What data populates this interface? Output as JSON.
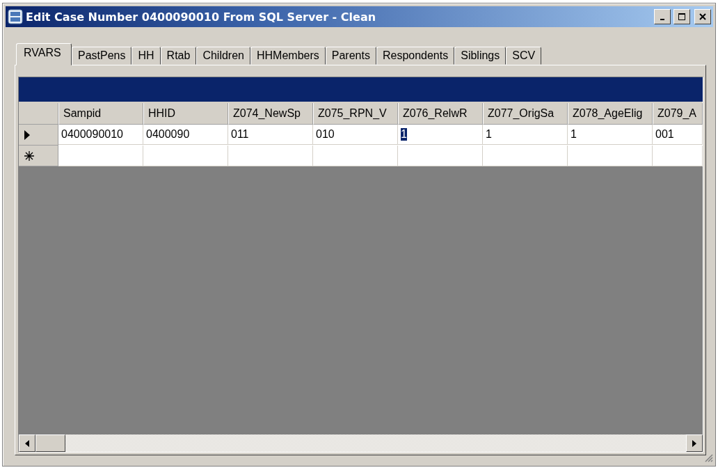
{
  "window": {
    "title": "Edit Case Number 0400090010 From SQL Server - Clean"
  },
  "tabs": [
    {
      "label": "RVARS",
      "selected": true
    },
    {
      "label": "PastPens",
      "selected": false
    },
    {
      "label": "HH",
      "selected": false
    },
    {
      "label": "Rtab",
      "selected": false
    },
    {
      "label": "Children",
      "selected": false
    },
    {
      "label": "HHMembers",
      "selected": false
    },
    {
      "label": "Parents",
      "selected": false
    },
    {
      "label": "Respondents",
      "selected": false
    },
    {
      "label": "Siblings",
      "selected": false
    },
    {
      "label": "SCV",
      "selected": false
    }
  ],
  "table": {
    "columns": [
      "Sampid",
      "HHID",
      "Z074_NewSp",
      "Z075_RPN_V",
      "Z076_RelwR",
      "Z077_OrigSa",
      "Z078_AgeElig",
      "Z079_A"
    ],
    "rows": [
      {
        "kind": "current",
        "cells": [
          {
            "text": "0400090010",
            "selected": false
          },
          {
            "text": "0400090",
            "selected": false
          },
          {
            "text": "011",
            "selected": false
          },
          {
            "text": "010",
            "selected": false
          },
          {
            "text": "1",
            "selected": true
          },
          {
            "text": "1",
            "selected": false
          },
          {
            "text": "1",
            "selected": false
          },
          {
            "text": "001",
            "selected": false
          }
        ]
      },
      {
        "kind": "new"
      }
    ]
  }
}
